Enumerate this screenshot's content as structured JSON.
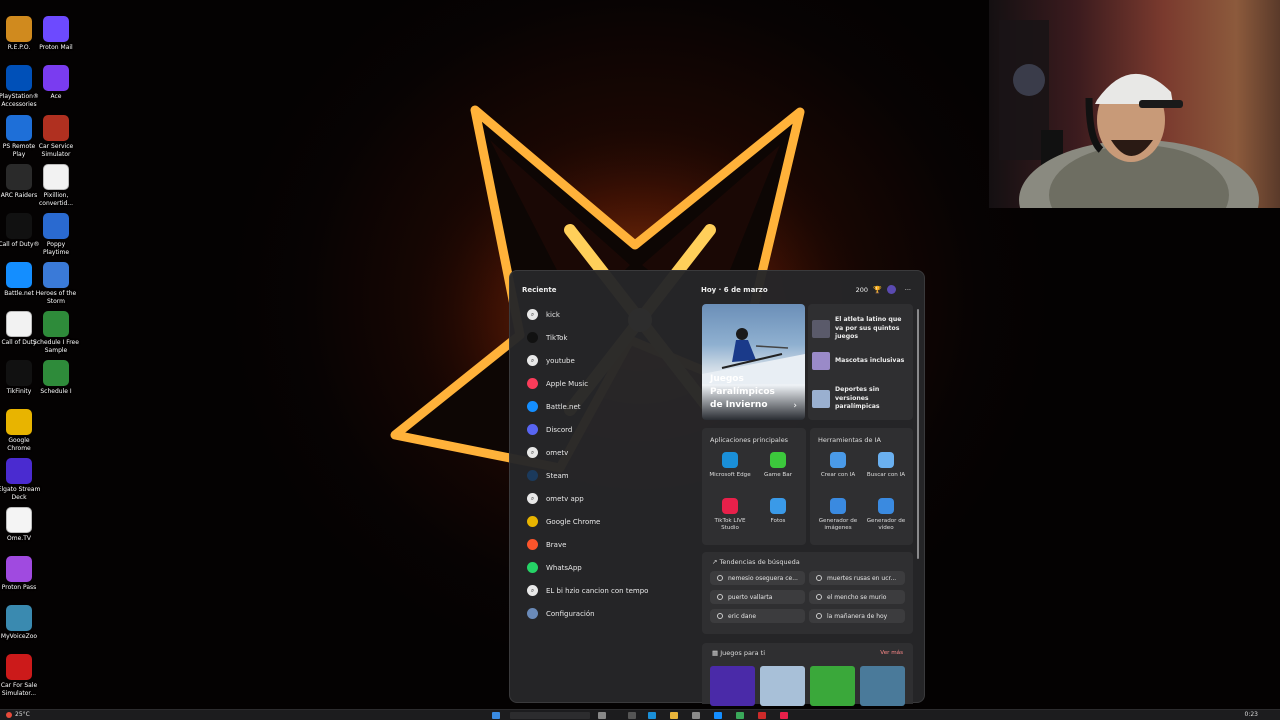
{
  "desktop": {
    "icons": [
      {
        "label": "R.E.P.O.",
        "icon": "repo-icon",
        "color": "#d08a1e"
      },
      {
        "label": "Proton Mail",
        "icon": "proton-mail-icon",
        "color": "#6d4aff"
      },
      {
        "label": "PlayStation® Accessories",
        "icon": "playstation-icon",
        "color": "#0050b8"
      },
      {
        "label": "Ace",
        "icon": "ace-icon",
        "color": "#7a3cf0"
      },
      {
        "label": "PS Remote Play",
        "icon": "ps-remote-play-icon",
        "color": "#1e6fd8"
      },
      {
        "label": "Car Service Simulator",
        "icon": "car-service-icon",
        "color": "#b03020"
      },
      {
        "label": "ARC Raiders",
        "icon": "arc-raiders-icon",
        "color": "#2a2a2a"
      },
      {
        "label": "Pixillion, convertid...",
        "icon": "document-icon",
        "color": "#f2f2f2"
      },
      {
        "label": "Call of Duty®",
        "icon": "call-of-duty-icon",
        "color": "#111111"
      },
      {
        "label": "Poppy Playtime",
        "icon": "poppy-playtime-icon",
        "color": "#2a6ad0"
      },
      {
        "label": "Battle.net",
        "icon": "battlenet-icon",
        "color": "#148eff"
      },
      {
        "label": "Heroes of the Storm",
        "icon": "heroes-storm-icon",
        "color": "#3a7ad8"
      },
      {
        "label": "Call of Duty",
        "icon": "document-icon",
        "color": "#f2f2f2"
      },
      {
        "label": "Schedule I Free Sample",
        "icon": "schedule-icon",
        "color": "#2e8b3a"
      },
      {
        "label": "TikFinity",
        "icon": "tikfinity-icon",
        "color": "#111111"
      },
      {
        "label": "Schedule I",
        "icon": "schedule-icon",
        "color": "#2e8b3a"
      },
      {
        "label": "Google Chrome",
        "icon": "chrome-icon",
        "color": "#e8b400"
      },
      {
        "label": "Elgato Stream Deck",
        "icon": "stream-deck-icon",
        "color": "#4a2bd0"
      },
      {
        "label": "Ome.TV",
        "icon": "ometv-icon",
        "color": "#f4f4f4"
      },
      {
        "label": "Proton Pass",
        "icon": "proton-pass-icon",
        "color": "#a04ae0"
      },
      {
        "label": "MyVoiceZoo",
        "icon": "myvoicezoo-icon",
        "color": "#3a8ab0"
      },
      {
        "label": "Car For Sale Simulator...",
        "icon": "car-for-sale-icon",
        "color": "#cc1a1a"
      }
    ]
  },
  "panel": {
    "recent_title": "Reciente",
    "recent": [
      {
        "label": "kick",
        "icon": "search-icon",
        "color": "#e8e8e8"
      },
      {
        "label": "TikTok",
        "icon": "tiktok-icon",
        "color": "#111111"
      },
      {
        "label": "youtube",
        "icon": "search-icon",
        "color": "#e8e8e8"
      },
      {
        "label": "Apple Music",
        "icon": "apple-music-icon",
        "color": "#fa3c5a"
      },
      {
        "label": "Battle.net",
        "icon": "battlenet-icon",
        "color": "#148eff"
      },
      {
        "label": "Discord",
        "icon": "discord-icon",
        "color": "#5865f2"
      },
      {
        "label": "ometv",
        "icon": "search-icon",
        "color": "#e8e8e8"
      },
      {
        "label": "Steam",
        "icon": "steam-icon",
        "color": "#1b3a5c"
      },
      {
        "label": "ometv app",
        "icon": "search-icon",
        "color": "#e8e8e8"
      },
      {
        "label": "Google Chrome",
        "icon": "chrome-icon",
        "color": "#e8b400"
      },
      {
        "label": "Brave",
        "icon": "brave-icon",
        "color": "#fb542b"
      },
      {
        "label": "WhatsApp",
        "icon": "whatsapp-icon",
        "color": "#25d366"
      },
      {
        "label": "EL bi hzio cancion con tempo",
        "icon": "search-icon",
        "color": "#e8e8e8"
      },
      {
        "label": "Configuración",
        "icon": "gear-icon",
        "color": "#6a8ab8"
      }
    ],
    "today_label": "Hoy",
    "date_label": "6 de marzo",
    "points": "200",
    "hero_title": "Juegos Paralímpicos de Invierno",
    "news": [
      {
        "text": "El atleta latino que va por sus quintos juegos"
      },
      {
        "text": "Mascotas inclusivas"
      },
      {
        "text": "Deportes sin versiones paralímpicas"
      }
    ],
    "apps_title": "Aplicaciones principales",
    "apps": [
      {
        "label": "Microsoft Edge",
        "icon": "edge-icon",
        "color": "#1a8fd8"
      },
      {
        "label": "Game Bar",
        "icon": "game-bar-icon",
        "color": "#3cc83c"
      },
      {
        "label": "TikTok LIVE Studio",
        "icon": "tiktok-live-icon",
        "color": "#e8204a"
      },
      {
        "label": "Fotos",
        "icon": "photos-icon",
        "color": "#3a9ae8"
      }
    ],
    "ai_title": "Herramientas de IA",
    "ai_tools": [
      {
        "label": "Crear con IA",
        "icon": "create-ai-icon",
        "color": "#4a9ae8"
      },
      {
        "label": "Buscar con IA",
        "icon": "search-ai-icon",
        "color": "#6ab0f0"
      },
      {
        "label": "Generador de imágenes",
        "icon": "image-generator-icon",
        "color": "#3a8ae0"
      },
      {
        "label": "Generador de vídeo",
        "icon": "video-generator-icon",
        "color": "#3a8ae0"
      }
    ],
    "trends_title": "Tendencias de búsqueda",
    "trends": [
      "nemesio oseguera ce...",
      "muertes rusas en ucr...",
      "puerto vallarta",
      "el mencho se murio",
      "eric dane",
      "la mañanera de hoy"
    ],
    "games_title": "Juegos para ti",
    "games_more": "Ver más",
    "games": [
      {
        "icon": "game-arrow-icon",
        "color": "#4a2aa8"
      },
      {
        "icon": "game-stickman-icon",
        "color": "#a8c0d8"
      },
      {
        "icon": "game-frog-icon",
        "color": "#3aa83a"
      },
      {
        "icon": "game-man-icon",
        "color": "#4a7a9a"
      }
    ]
  },
  "taskbar": {
    "temperature": "25°C",
    "time": "0:23"
  }
}
